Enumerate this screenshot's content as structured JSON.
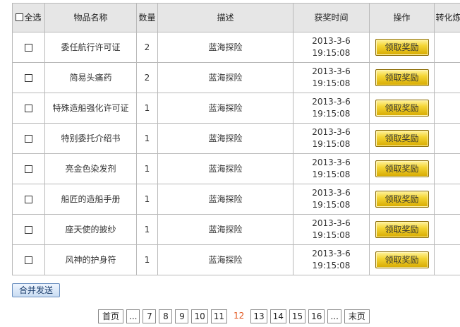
{
  "table": {
    "headers": {
      "select_all": "全选",
      "item_name": "物品名称",
      "quantity": "数量",
      "description": "描述",
      "time": "获奖时间",
      "action": "操作",
      "convert": "转化炼成"
    },
    "rows": [
      {
        "name": "委任航行许可证",
        "qty": "2",
        "desc": "蓝海探险",
        "date": "2013-3-6",
        "time": "19:15:08",
        "button": "领取奖励"
      },
      {
        "name": "简易头痛药",
        "qty": "2",
        "desc": "蓝海探险",
        "date": "2013-3-6",
        "time": "19:15:08",
        "button": "领取奖励"
      },
      {
        "name": "特殊造船强化许可证",
        "qty": "1",
        "desc": "蓝海探险",
        "date": "2013-3-6",
        "time": "19:15:08",
        "button": "领取奖励"
      },
      {
        "name": "特别委托介绍书",
        "qty": "1",
        "desc": "蓝海探险",
        "date": "2013-3-6",
        "time": "19:15:08",
        "button": "领取奖励"
      },
      {
        "name": "亮金色染发剂",
        "qty": "1",
        "desc": "蓝海探险",
        "date": "2013-3-6",
        "time": "19:15:08",
        "button": "领取奖励"
      },
      {
        "name": "船匠的造船手册",
        "qty": "1",
        "desc": "蓝海探险",
        "date": "2013-3-6",
        "time": "19:15:08",
        "button": "领取奖励"
      },
      {
        "name": "座天使的披纱",
        "qty": "1",
        "desc": "蓝海探险",
        "date": "2013-3-6",
        "time": "19:15:08",
        "button": "领取奖励"
      },
      {
        "name": "风神的护身符",
        "qty": "1",
        "desc": "蓝海探险",
        "date": "2013-3-6",
        "time": "19:15:08",
        "button": "领取奖励"
      }
    ]
  },
  "merge_button": "合并发送",
  "pager": {
    "first": "首页",
    "ellipsis": "...",
    "pages": [
      "7",
      "8",
      "9",
      "10",
      "11",
      "12",
      "13",
      "14",
      "15",
      "16"
    ],
    "current": "12",
    "last": "末页"
  },
  "colors": {
    "header_bg": "#e6e6e6",
    "border": "#b9b9b9",
    "claim_button": "#f4d534",
    "current_page": "#e2541b"
  }
}
